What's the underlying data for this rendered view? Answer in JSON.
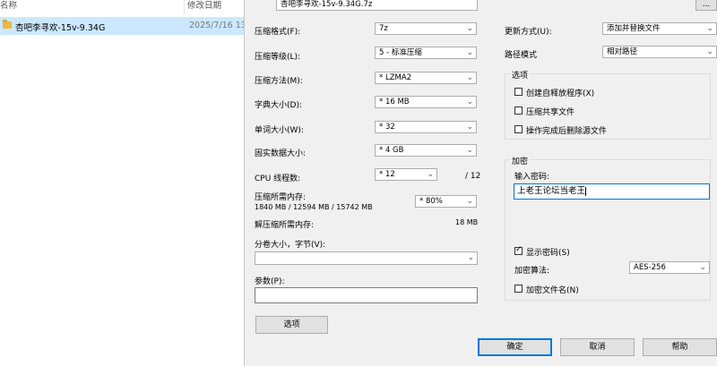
{
  "explorer": {
    "col_name": "名称",
    "col_date": "修改日期",
    "file_name": "杏吧李寻欢-15v-9.34G",
    "file_date": "2025/7/16 13"
  },
  "dialog": {
    "archive_path": "杏吧李寻欢-15v-9.34G.7z",
    "browse_label": "...",
    "format_label": "压缩格式(F):",
    "format_value": "7z",
    "level_label": "压缩等级(L):",
    "level_value": "5 - 标准压缩",
    "method_label": "压缩方法(M):",
    "method_value": "* LZMA2",
    "dict_label": "字典大小(D):",
    "dict_value": "* 16 MB",
    "word_label": "单词大小(W):",
    "word_value": "* 32",
    "solid_label": "固实数据大小:",
    "solid_value": "* 4 GB",
    "cpu_label": "CPU 线程数:",
    "cpu_value": "* 12",
    "cpu_total": "/ 12",
    "mem_comp_label": "压缩所需内存:",
    "mem_comp_detail": "1840 MB / 12594 MB / 15742 MB",
    "mem_percent": "* 80%",
    "mem_decomp_label": "解压缩所需内存:",
    "mem_decomp_value": "18 MB",
    "split_label": "分卷大小，字节(V):",
    "split_value": "",
    "params_label": "参数(P):",
    "params_value": "",
    "options_button": "选项",
    "update_label": "更新方式(U):",
    "update_value": "添加并替换文件",
    "path_label": "路径模式",
    "path_value": "相对路径",
    "options_group": "选项",
    "opt_sfx": "创建自释放程序(X)",
    "opt_shared": "压缩共享文件",
    "opt_delete": "操作完成后删除源文件",
    "enc_group": "加密",
    "pwd_label": "输入密码:",
    "pwd_value": "上老王论坛当老王",
    "show_pwd": "显示密码(S)",
    "enc_method_label": "加密算法:",
    "enc_method_value": "AES-256",
    "enc_names": "加密文件名(N)",
    "ok_button": "确定",
    "cancel_button": "取消",
    "help_button": "帮助"
  }
}
